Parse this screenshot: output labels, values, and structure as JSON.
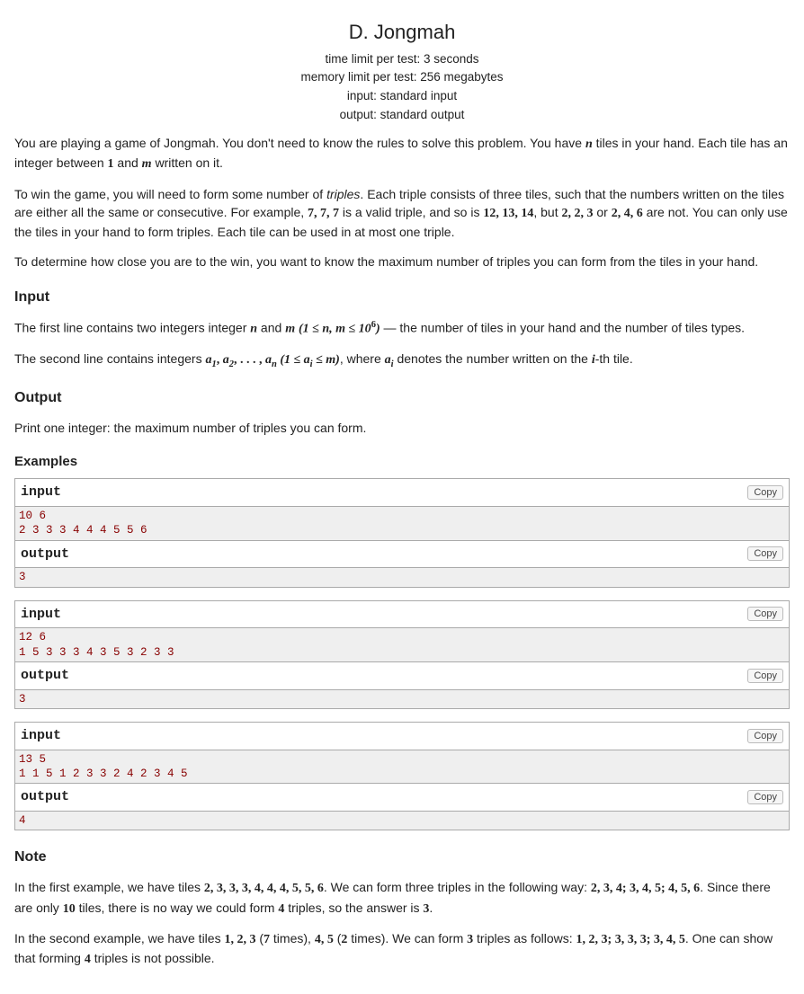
{
  "header": {
    "title": "D. Jongmah",
    "time_limit": "time limit per test: 3 seconds",
    "memory_limit": "memory limit per test: 256 megabytes",
    "input_file": "input: standard input",
    "output_file": "output: standard output"
  },
  "statement": {
    "p1a": "You are playing a game of Jongmah. You don't need to know the rules to solve this problem. You have ",
    "p1b": " tiles in your hand. Each tile has an integer between ",
    "p1c": " and ",
    "p1d": " written on it.",
    "p2a": "To win the game, you will need to form some number of ",
    "triples_word": "triples",
    "p2b": ". Each triple consists of three tiles, such that the numbers written on the tiles are either all the same or consecutive. For example, ",
    "p2c": " is a valid triple, and so is ",
    "p2d": ", but ",
    "p2e": " or ",
    "p2f": " are not. You can only use the tiles in your hand to form triples. Each tile can be used in at most one triple.",
    "p3": "To determine how close you are to the win, you want to know the maximum number of triples you can form from the tiles in your hand."
  },
  "input": {
    "heading": "Input",
    "p1a": "The first line contains two integers integer ",
    "p1b": " and ",
    "p1c": " — the number of tiles in your hand and the number of tiles types.",
    "p2a": "The second line contains integers ",
    "p2b": ", where ",
    "p2c": " denotes the number written on the ",
    "p2d": "-th tile."
  },
  "output": {
    "heading": "Output",
    "p1": "Print one integer: the maximum number of triples you can form."
  },
  "examples_heading": "Examples",
  "labels": {
    "input": "input",
    "output": "output",
    "copy": "Copy"
  },
  "examples": [
    {
      "input": "10 6\n2 3 3 3 4 4 4 5 5 6",
      "output": "3"
    },
    {
      "input": "12 6\n1 5 3 3 3 4 3 5 3 2 3 3",
      "output": "3"
    },
    {
      "input": "13 5\n1 1 5 1 2 3 3 2 4 2 3 4 5",
      "output": "4"
    }
  ],
  "note": {
    "heading": "Note",
    "p1a": "In the first example, we have tiles ",
    "p1b": ". We can form three triples in the following way: ",
    "p1c": ". Since there are only ",
    "p1d": " tiles, there is no way we could form ",
    "p1e": " triples, so the answer is ",
    "p1f": ".",
    "p2a": "In the second example, we have tiles ",
    "p2b": " (",
    "p2c": " times), ",
    "p2d": " (",
    "p2e": " times). We can form ",
    "p2f": " triples as follows: ",
    "p2g": ". One can show that forming ",
    "p2h": " triples is not possible."
  },
  "math": {
    "n": "n",
    "m": "m",
    "one": "1",
    "ten": "10",
    "t777": "7, 7, 7",
    "t121314": "12, 13, 14",
    "t223": "2, 2, 3",
    "t246": "2, 4, 6",
    "nm_range": "(1 ≤ n, m ≤ 10",
    "nm_range_exp": "6",
    "nm_range_close": ")",
    "a_seq": "a",
    "ai_range": " (1 ≤ a",
    "ai_range_close": " ≤ m)",
    "ai": "a",
    "i_var": "i",
    "note_tiles1": "2, 3, 3, 3, 4, 4, 4, 5, 5, 6",
    "note_trip1": "2, 3, 4; 3, 4, 5; 4, 5, 6",
    "note_four": "4",
    "note_three": "3",
    "note_tiles2a": "1, 2, 3",
    "note_seven": "7",
    "note_tiles2b": "4, 5",
    "note_two": "2",
    "note_trip2": "1, 2, 3; 3, 3, 3; 3, 4, 5"
  }
}
